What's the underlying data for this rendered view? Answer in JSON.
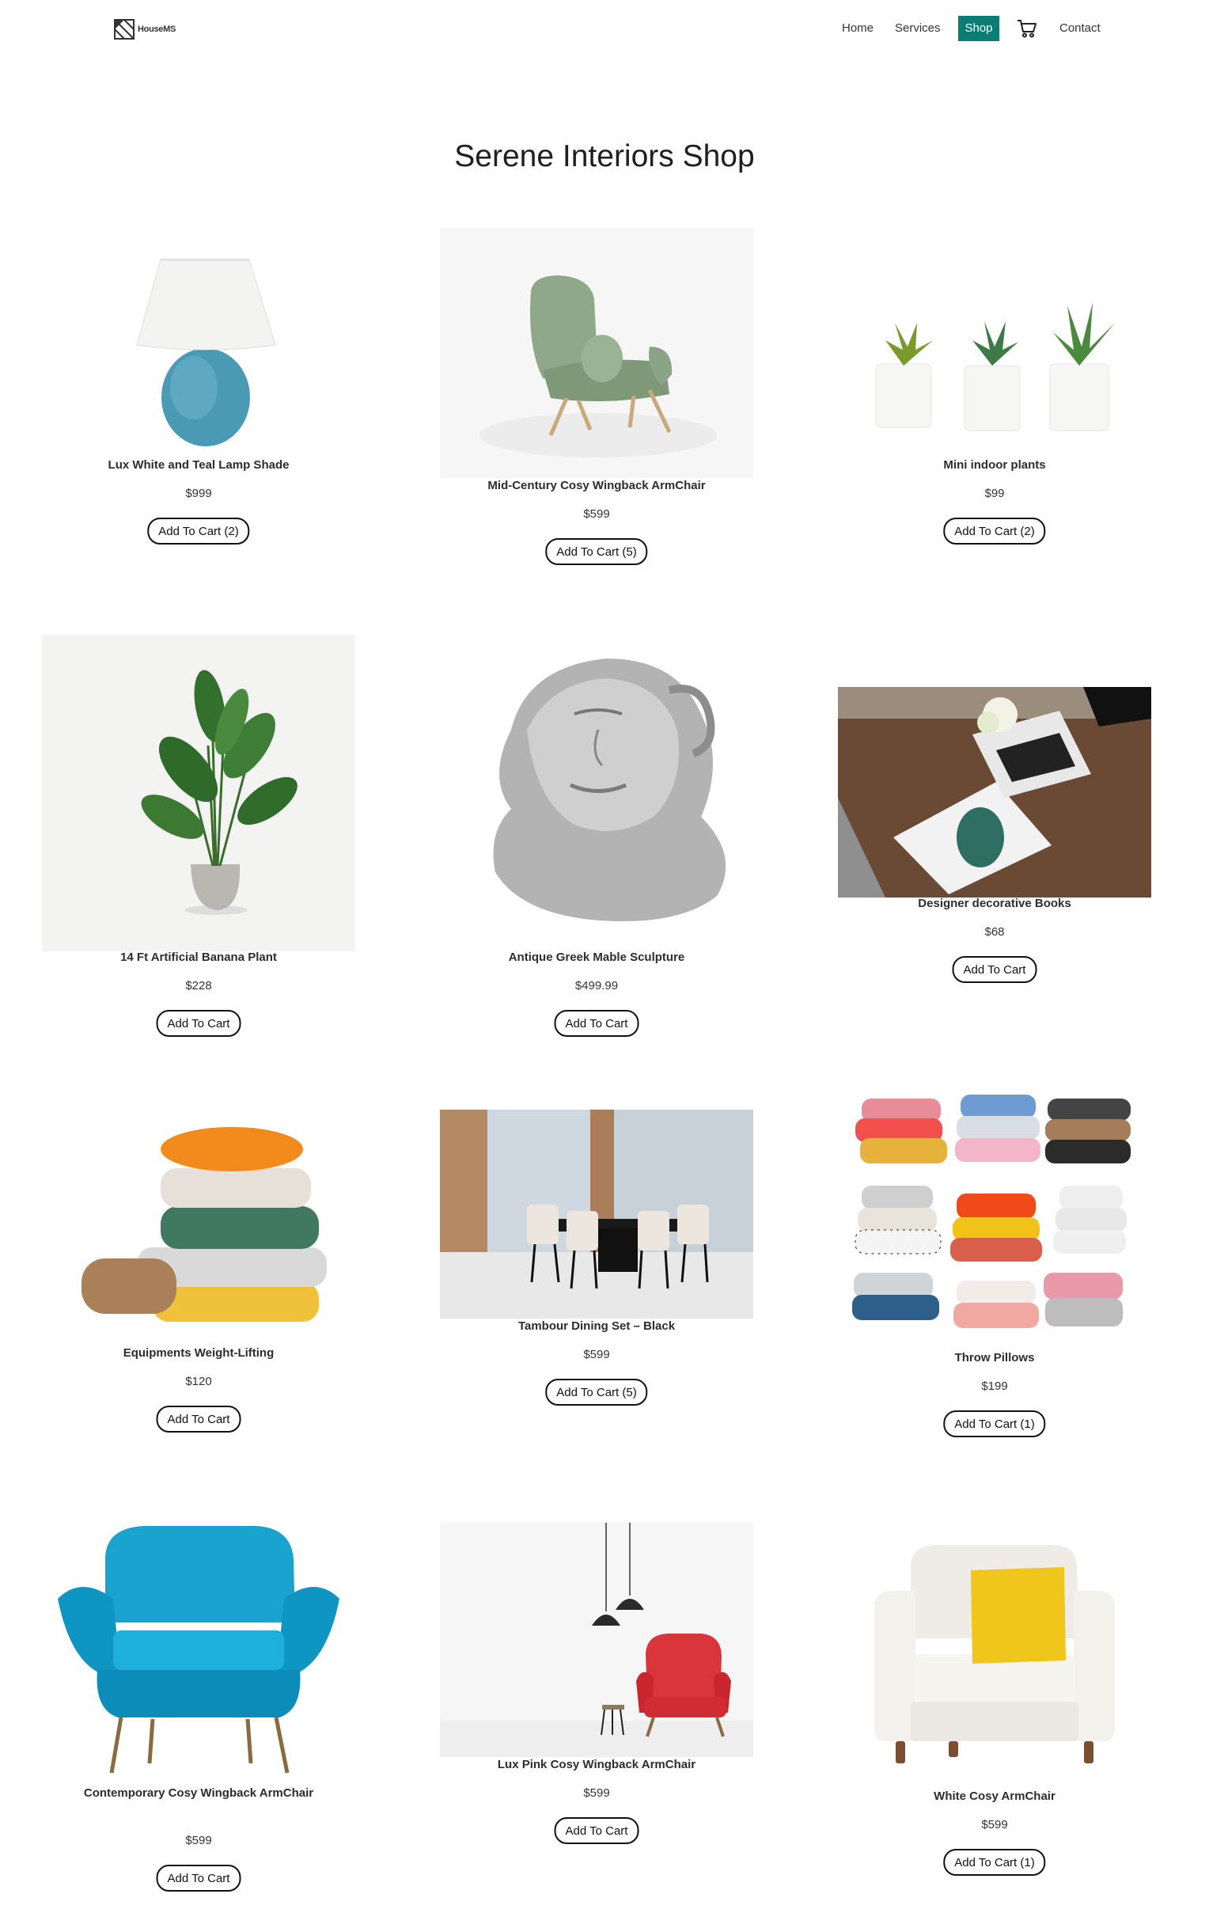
{
  "header": {
    "logo_text": "HouseMS",
    "nav": {
      "home": "Home",
      "services": "Services",
      "shop": "Shop",
      "cart_icon": "shopping-cart-icon",
      "contact": "Contact"
    },
    "active_color": "#0b7d74"
  },
  "page": {
    "title": "Serene Interiors Shop"
  },
  "products": [
    {
      "name": "Lux White and Teal Lamp Shade",
      "price": "$999",
      "button": "Add To Cart (2)"
    },
    {
      "name": "Mid-Century Cosy Wingback ArmChair",
      "price": "$599",
      "button": "Add To Cart (5)"
    },
    {
      "name": "Mini indoor plants",
      "price": "$99",
      "button": "Add To Cart (2)"
    },
    {
      "name": "14 Ft Artificial Banana Plant",
      "price": "$228",
      "button": "Add To Cart"
    },
    {
      "name": "Antique Greek Mable Sculpture",
      "price": "$499.99",
      "button": "Add To Cart"
    },
    {
      "name": "Designer decorative Books",
      "price": "$68",
      "button": "Add To Cart"
    },
    {
      "name": "Equipments Weight-Lifting",
      "price": "$120",
      "button": "Add To Cart"
    },
    {
      "name": "Tambour Dining Set – Black",
      "price": "$599",
      "button": "Add To Cart (5)"
    },
    {
      "name": "Throw Pillows",
      "price": "$199",
      "button": "Add To Cart (1)"
    },
    {
      "name": "Contemporary Cosy Wingback ArmChair",
      "price": "$599",
      "button": "Add To Cart"
    },
    {
      "name": "Lux Pink Cosy Wingback ArmChair",
      "price": "$599",
      "button": "Add To Cart"
    },
    {
      "name": "White Cosy ArmChair",
      "price": "$599",
      "button": "Add To Cart (1)"
    }
  ]
}
